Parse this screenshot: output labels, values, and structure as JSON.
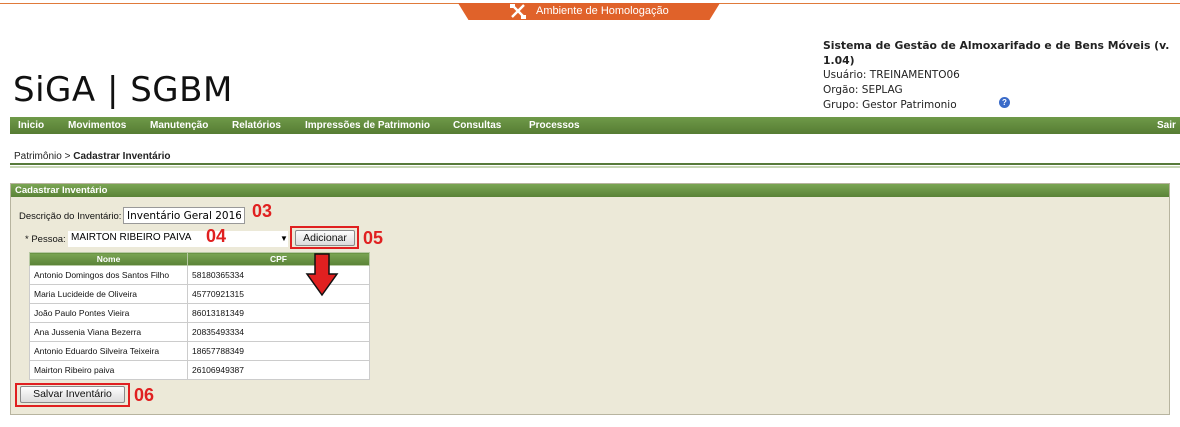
{
  "env": {
    "label": "Ambiente de Homologação",
    "accent": "#e0622a"
  },
  "logo": {
    "text": "SiGA | SGBM"
  },
  "sysinfo": {
    "title": "Sistema de Gestão de Almoxarifado e de Bens Móveis (v. 1.04)",
    "user": "Usuário: TREINAMENTO06",
    "org": "Orgão: SEPLAG",
    "group": "Grupo: Gestor Patrimonio"
  },
  "nav": {
    "items": [
      "Inicio",
      "Movimentos",
      "Manutenção",
      "Relatórios",
      "Impressões de Patrimonio",
      "Consultas",
      "Processos"
    ],
    "logout": "Sair"
  },
  "breadcrumb": {
    "parent": "Patrimônio",
    "sep": ">",
    "current": "Cadastrar Inventário"
  },
  "panel": {
    "title": "Cadastrar Inventário",
    "desc_label": "Descrição do Inventário:",
    "desc_value": "Inventário Geral 2016",
    "pessoa_label": "* Pessoa:",
    "pessoa_value": "MAIRTON RIBEIRO PAIVA",
    "add_label": "Adicionar",
    "save_label": "Salvar Inventário"
  },
  "steps": {
    "s03": "03",
    "s04": "04",
    "s05": "05",
    "s06": "06"
  },
  "table": {
    "headers": [
      "Nome",
      "CPF"
    ],
    "rows": [
      [
        "Antonio Domingos dos Santos Filho",
        "58180365334"
      ],
      [
        "Maria Lucideide de Oliveira",
        "45770921315"
      ],
      [
        "João Paulo Pontes Vieira",
        "86013181349"
      ],
      [
        "Ana Jussenia Viana Bezerra",
        "20835493334"
      ],
      [
        "Antonio Eduardo Silveira Teixeira",
        "18657788349"
      ],
      [
        "Mairton Ribeiro paiva",
        "26106949387"
      ]
    ]
  }
}
